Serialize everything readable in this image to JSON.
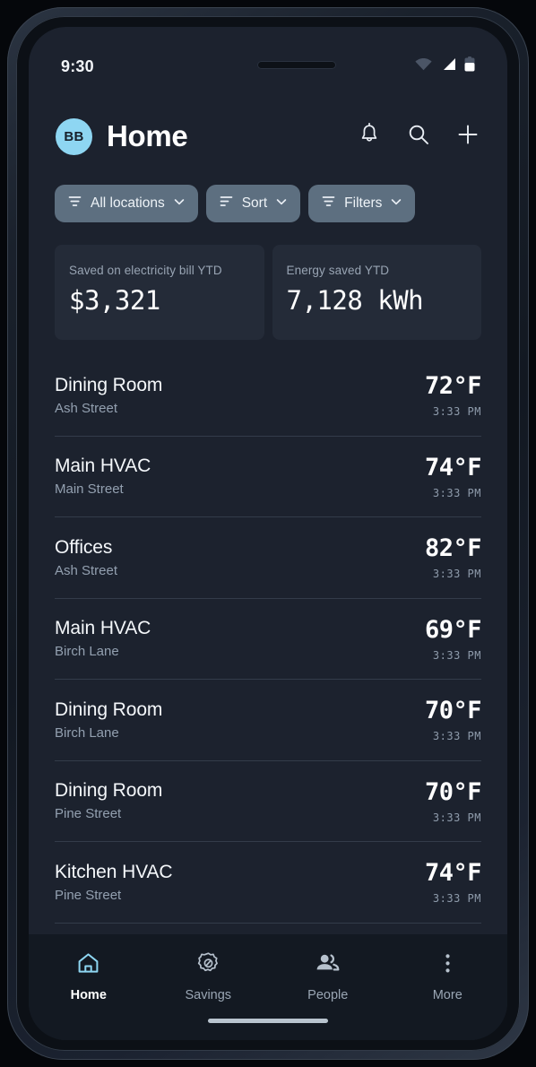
{
  "status_bar": {
    "time": "9:30",
    "icons": [
      "wifi-icon",
      "cellular-signal-icon",
      "battery-icon"
    ]
  },
  "app_bar": {
    "avatar_initials": "BB",
    "title": "Home",
    "actions": [
      {
        "name": "notifications-icon",
        "label": "Notifications"
      },
      {
        "name": "search-icon",
        "label": "Search"
      },
      {
        "name": "add-icon",
        "label": "Add"
      }
    ]
  },
  "chips": [
    {
      "label": "All locations",
      "icon": "filter-icon",
      "chevron": "chevron-down-icon"
    },
    {
      "label": "Sort",
      "icon": "sort-icon",
      "chevron": "chevron-down-icon"
    },
    {
      "label": "Filters",
      "icon": "filter-icon",
      "chevron": "chevron-down-icon"
    }
  ],
  "stat_cards": [
    {
      "label": "Saved on electricity bill YTD",
      "value": "$3,321"
    },
    {
      "label": "Energy saved YTD",
      "value": "7,128 kWh"
    }
  ],
  "devices": [
    {
      "title": "Dining Room",
      "location": "Ash Street",
      "temperature": "72°F",
      "time": "3:33 PM"
    },
    {
      "title": "Main HVAC",
      "location": "Main Street",
      "temperature": "74°F",
      "time": "3:33 PM"
    },
    {
      "title": "Offices",
      "location": "Ash Street",
      "temperature": "82°F",
      "time": "3:33 PM"
    },
    {
      "title": "Main HVAC",
      "location": "Birch Lane",
      "temperature": "69°F",
      "time": "3:33 PM"
    },
    {
      "title": "Dining Room",
      "location": "Birch Lane",
      "temperature": "70°F",
      "time": "3:33 PM"
    },
    {
      "title": "Dining Room",
      "location": "Pine Street",
      "temperature": "70°F",
      "time": "3:33 PM"
    },
    {
      "title": "Kitchen HVAC",
      "location": "Pine Street",
      "temperature": "74°F",
      "time": "3:33 PM"
    }
  ],
  "bottom_nav": [
    {
      "label": "Home",
      "icon": "home-icon",
      "active": true
    },
    {
      "label": "Savings",
      "icon": "eco-badge-icon",
      "active": false
    },
    {
      "label": "People",
      "icon": "people-icon",
      "active": false
    },
    {
      "label": "More",
      "icon": "more-vert-icon",
      "active": false
    }
  ],
  "colors": {
    "screen_background": "#1c222e",
    "card_background": "#242b38",
    "chip_background": "#5d6f80",
    "nav_background": "#131922",
    "accent": "#8ed6f2",
    "divider": "#333c4a",
    "muted_text": "#93a0b0"
  }
}
